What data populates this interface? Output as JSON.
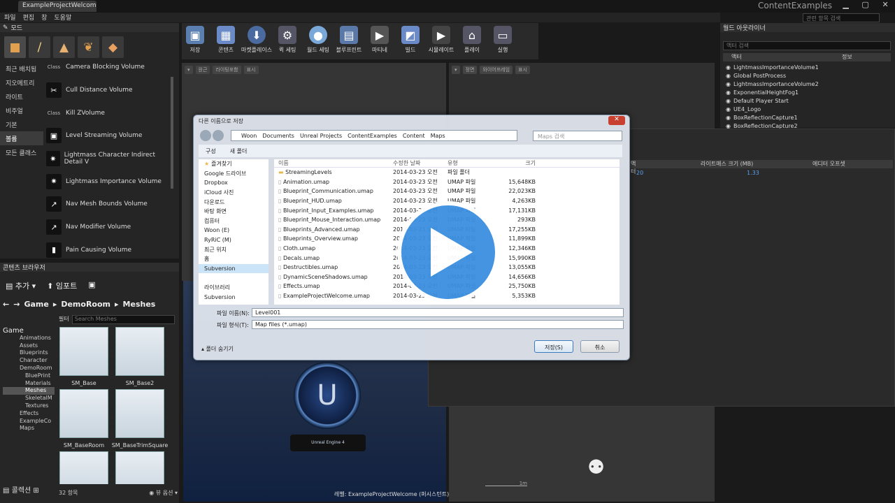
{
  "window": {
    "doc_tab": "ExampleProjectWelcome",
    "app_title": "ContentExamples",
    "help_search_placeholder": "관련 항목 검색"
  },
  "menu": [
    "파일",
    "편집",
    "창",
    "도움말"
  ],
  "modes": {
    "tab": "모드",
    "icons": [
      "place-icon",
      "paint-icon",
      "landscape-icon",
      "foliage-icon",
      "geometry-icon"
    ],
    "categories": [
      "최근 배치됨",
      "지오메트리",
      "라이트",
      "비주얼",
      "기본",
      "볼륨",
      "모든 클래스"
    ],
    "active_category": "볼륨",
    "volumes": [
      {
        "label": "Camera Blocking Volume",
        "icon": "Class"
      },
      {
        "label": "Cull Distance Volume",
        "icon": "icon"
      },
      {
        "label": "Kill ZVolume",
        "icon": "Class"
      },
      {
        "label": "Level Streaming Volume",
        "icon": "icon"
      },
      {
        "label": "Lightmass Character Indirect Detail V",
        "icon": "icon"
      },
      {
        "label": "Lightmass Importance Volume",
        "icon": "icon"
      },
      {
        "label": "Nav Mesh Bounds Volume",
        "icon": "icon"
      },
      {
        "label": "Nav Modifier Volume",
        "icon": "icon"
      },
      {
        "label": "Pain Causing Volume",
        "icon": "icon"
      }
    ]
  },
  "toolbar": [
    {
      "label": "저장",
      "icon": "save-icon",
      "color": "#5a7fb0"
    },
    {
      "label": "콘텐츠",
      "icon": "content-icon",
      "color": "#6a8ac8"
    },
    {
      "label": "마켓플레이스",
      "icon": "marketplace-icon",
      "color": "#4a6aa0"
    },
    {
      "label": "퀵 세팅",
      "icon": "settings-icon",
      "color": "#556"
    },
    {
      "label": "월드 세팅",
      "icon": "world-icon",
      "color": "#7aa8d8"
    },
    {
      "label": "블루프린트",
      "icon": "blueprint-icon",
      "color": "#5a78a8"
    },
    {
      "label": "마티네",
      "icon": "matinee-icon",
      "color": "#555"
    },
    {
      "label": "빌드",
      "icon": "build-icon",
      "color": "#6a8ac8"
    },
    {
      "label": "시뮬레이트",
      "icon": "simulate-icon",
      "color": "#444"
    },
    {
      "label": "플레이",
      "icon": "play-icon",
      "color": "#556"
    },
    {
      "label": "실행",
      "icon": "launch-icon",
      "color": "#556"
    }
  ],
  "viewports": {
    "tl_chips": [
      "원근",
      "라이팅포함",
      "표시"
    ],
    "tr_chips": [
      "정면",
      "와이어프레임",
      "표시"
    ],
    "level_label": "레벨: ExampleProjectWelcome (퍼시스턴트)",
    "grid_scale": "1m",
    "plaque": "Unreal Engine 4"
  },
  "outliner": {
    "tab": "월드 아웃라이너",
    "search_placeholder": "액터 검색",
    "columns": [
      "액터",
      "정보"
    ],
    "rows": [
      "LightmassImportanceVolume1",
      "Global PostProcess",
      "LightmassImportanceVolume2",
      "ExponentialHeightFog1",
      "Default Player Start",
      "UE4_Logo",
      "BoxReflectionCapture1",
      "BoxReflectionCapture2"
    ]
  },
  "stats": {
    "columns": [
      "액터",
      "라이트매스 크기 (MB)",
      "에디터 오프셋"
    ],
    "row": [
      "20",
      "1.33",
      ""
    ]
  },
  "content_browser": {
    "tab": "콘텐츠 브라우저",
    "add_label": "추가",
    "import_label": "임포트",
    "path": [
      "Game",
      "DemoRoom",
      "Meshes"
    ],
    "filter_label": "필터",
    "search_placeholder": "Search Meshes",
    "tree": [
      "Game",
      "Animations",
      "Assets",
      "Blueprints",
      "Character",
      "DemoRoom",
      "BluePrint",
      "Materials",
      "Meshes",
      "SkeletalM",
      "Textures",
      "Effects",
      "ExampleCo",
      "Maps"
    ],
    "assets": [
      "SM_Base",
      "SM_Base2",
      "SM_BaseRoom",
      "SM_BaseTrimSquare",
      "",
      ""
    ],
    "count": "32 항목",
    "view_options": "뷰 옵션",
    "collections": "콜렉션"
  },
  "dialog": {
    "title": "다른 이름으로 저장",
    "path": [
      "Woon",
      "Documents",
      "Unreal Projects",
      "ContentExamples",
      "Content",
      "Maps"
    ],
    "search_placeholder": "Maps 검색",
    "organize": "구성",
    "new_folder": "새 폴더",
    "sidebar": [
      "즐겨찾기",
      "Google 드라이브",
      "Dropbox",
      "iCloud 사진",
      "다운로드",
      "바탕 화면",
      "컴퓨터",
      "Woon (E)",
      "RyRiC (M)",
      "최근 위치",
      "홈",
      "Subversion",
      "",
      "라이브러리",
      "Subversion"
    ],
    "columns": [
      "이름",
      "수정한 날짜",
      "유형",
      "크기"
    ],
    "files": [
      {
        "name": "StreamingLevels",
        "date": "2014-03-23 오전",
        "type": "파일 폴더",
        "size": "",
        "folder": true
      },
      {
        "name": "Animation.umap",
        "date": "2014-03-23 오전",
        "type": "UMAP 파일",
        "size": "15,648KB"
      },
      {
        "name": "Blueprint_Communication.umap",
        "date": "2014-03-23 오전",
        "type": "UMAP 파일",
        "size": "22,023KB"
      },
      {
        "name": "Blueprint_HUD.umap",
        "date": "2014-03-23 오전",
        "type": "UMAP 파일",
        "size": "4,263KB"
      },
      {
        "name": "Blueprint_Input_Examples.umap",
        "date": "2014-03-23 오전",
        "type": "UMAP 파일",
        "size": "17,131KB"
      },
      {
        "name": "Blueprint_Mouse_Interaction.umap",
        "date": "2014-03-23 오전",
        "type": "UMAP 파일",
        "size": "293KB"
      },
      {
        "name": "Blueprints_Advanced.umap",
        "date": "2014-03-23 오전",
        "type": "UMAP 파일",
        "size": "17,255KB"
      },
      {
        "name": "Blueprints_Overview.umap",
        "date": "2014-03-23 오전",
        "type": "UMAP 파일",
        "size": "11,899KB"
      },
      {
        "name": "Cloth.umap",
        "date": "2014-03-23 오전",
        "type": "UMAP 파일",
        "size": "12,346KB"
      },
      {
        "name": "Decals.umap",
        "date": "2014-03-23 오전",
        "type": "UMAP 파일",
        "size": "15,990KB"
      },
      {
        "name": "Destructibles.umap",
        "date": "2014-03-23 오전",
        "type": "UMAP 파일",
        "size": "13,055KB"
      },
      {
        "name": "DynamicSceneShadows.umap",
        "date": "2014-03-23 오전",
        "type": "UMAP 파일",
        "size": "14,656KB"
      },
      {
        "name": "Effects.umap",
        "date": "2014-03-23 오전",
        "type": "UMAP 파일",
        "size": "25,750KB"
      },
      {
        "name": "ExampleProjectWelcome.umap",
        "date": "2014-03-23 오전",
        "type": "UMAP 파일",
        "size": "5,353KB"
      }
    ],
    "filename_label": "파일 이름(N):",
    "filename_value": "Level001",
    "filetype_label": "파일 형식(T):",
    "filetype_value": "Map files (*.umap)",
    "hide_folders": "폴더 숨기기",
    "save": "저장(S)",
    "cancel": "취소"
  }
}
